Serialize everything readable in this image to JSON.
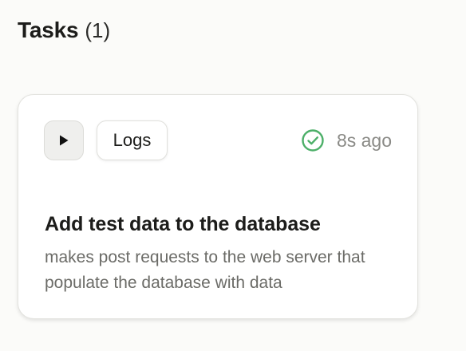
{
  "header": {
    "title": "Tasks",
    "count": "(1)"
  },
  "task": {
    "logs_label": "Logs",
    "status_time": "8s ago",
    "status": "success",
    "title": "Add test data to the database",
    "description": "makes post requests to the web server that populate the database with data"
  },
  "colors": {
    "success": "#4caf68",
    "background": "#fbfbf9",
    "card": "#ffffff"
  },
  "icons": {
    "run": "play-icon",
    "status": "check-circle-icon"
  }
}
